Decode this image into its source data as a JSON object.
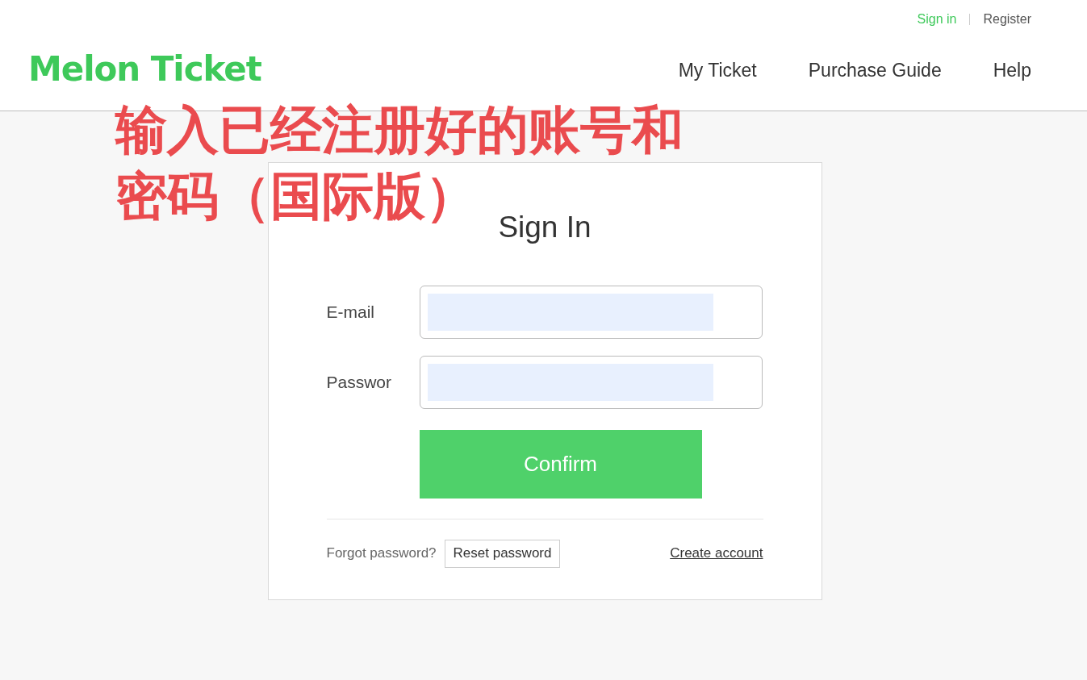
{
  "header": {
    "logo": "Melon Ticket",
    "top_links": [
      {
        "label": "Sign in",
        "selected": true
      },
      {
        "label": "Register",
        "selected": false
      }
    ],
    "nav": [
      "My Ticket",
      "Purchase Guide",
      "Help"
    ]
  },
  "annotation": {
    "lines": [
      "输入已经注册好的账号和",
      "密码（国际版）"
    ]
  },
  "sign_in": {
    "title": "Sign In",
    "fields": [
      {
        "label": "E-mail"
      },
      {
        "label": "Passwor"
      }
    ],
    "button": "Confirm",
    "forgot_text": "Forgot password?",
    "reset_button": "Reset password",
    "create_link": "Create account"
  }
}
